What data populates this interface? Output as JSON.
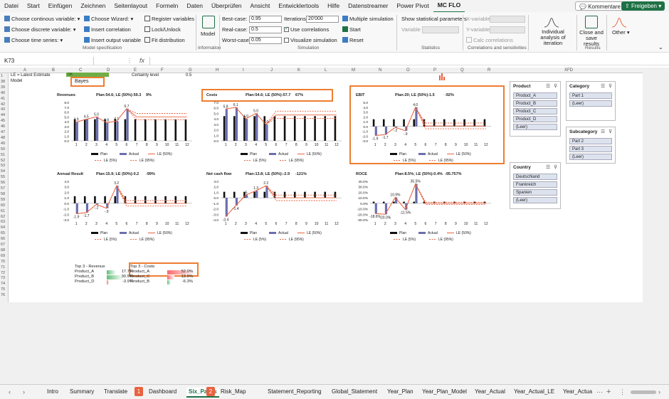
{
  "menu": {
    "tabs": [
      "Datei",
      "Start",
      "Einfügen",
      "Zeichnen",
      "Seitenlayout",
      "Formeln",
      "Daten",
      "Überprüfen",
      "Ansicht",
      "Entwicklertools",
      "Hilfe",
      "Datenstreamer",
      "Power Pivot",
      "MC FLO"
    ],
    "active": "MC FLO",
    "comments": "Kommentare",
    "share": "Freigeben"
  },
  "ribbon": {
    "model_spec": {
      "continuous": "Choose continous variable:",
      "discrete": "Choose discrete variable:",
      "time_series": "Choose time series:",
      "wizard": "Choose Wizard:",
      "insert_correlation": "Insert correlation",
      "insert_output": "Insert output variable",
      "register": "Register variables",
      "lock": "Lock/Unlock",
      "fit": "Fit distribution",
      "label": "Model specification"
    },
    "information": {
      "model": "Model",
      "label": "Information"
    },
    "simulation": {
      "best_case_label": "Best-case:",
      "best_case": "0.95",
      "real_case_label": "Real-case:",
      "real_case": "0.5",
      "worst_case_label": "Worst-case:",
      "worst_case": "0.05",
      "iterations_label": "Iterations:",
      "iterations": "20'000",
      "use_corr": "Use correlations",
      "visualize": "Visualize simulation",
      "multiple": "Multiple simulation",
      "start": "Start",
      "reset": "Reset",
      "label": "Simulation"
    },
    "statistics": {
      "show": "Show statistical parameters",
      "variable": "Variable",
      "label": "Statistics"
    },
    "correlations": {
      "xvar": "X-variable",
      "yvar": "Y-variable",
      "calc": "Calc correlations",
      "label": "Correlations and sensitivities"
    },
    "individual": "Individual analysis of iteration",
    "results": {
      "close": "Close and save results",
      "label": "Results"
    },
    "other": "Other"
  },
  "formula_bar": {
    "cell": "K73",
    "fx": "fx"
  },
  "columns": [
    "A",
    "B",
    "C",
    "D",
    "E",
    "F",
    "G",
    "H",
    "I",
    "J",
    "K",
    "L",
    "M",
    "N",
    "O",
    "P",
    "Q",
    "R",
    "XFD"
  ],
  "rows": [
    "1",
    "38",
    "39",
    "40",
    "41",
    "42",
    "43",
    "44",
    "45",
    "46",
    "47",
    "48",
    "49",
    "50",
    "51",
    "52",
    "53",
    "54",
    "55",
    "56",
    "57",
    "58",
    "59",
    "60",
    "61",
    "62",
    "63",
    "64",
    "65",
    "66",
    "67",
    "68",
    "69",
    "70",
    "71",
    "72",
    "73",
    "74",
    "75",
    "76"
  ],
  "cells": {
    "le_note": "LE = Latest Estimate",
    "ok": "OK",
    "certainty": "Certainty level",
    "certainty_value": "0.5",
    "model_label": "Model",
    "model_value": "Bayes"
  },
  "legend": {
    "plan": "Plan",
    "actual": "Actual",
    "le50": "LE (50%)",
    "le5": "LE (5%)",
    "le95": "LE (95%)"
  },
  "chart_data": [
    {
      "type": "bar",
      "title": "Revenues",
      "info": "Plan:54.6; LE (50%):59.3",
      "pct": "9%",
      "categories": [
        "1",
        "2",
        "3",
        "4",
        "5",
        "6",
        "7",
        "8",
        "9",
        "10",
        "11",
        "12"
      ],
      "ylim": [
        0,
        8
      ],
      "yticks": [
        "0.0",
        "1.0",
        "2.0",
        "3.0",
        "4.0",
        "5.0",
        "6.0",
        "7.0",
        "8.0"
      ],
      "series": [
        {
          "name": "Plan",
          "values": [
            4.5,
            4.5,
            4.5,
            4.5,
            4.5,
            4.5,
            4.5,
            4.5,
            4.5,
            4.5,
            4.5,
            4.5
          ]
        },
        {
          "name": "Actual",
          "values": [
            3.9,
            4.5,
            5.0,
            3.8,
            4.1,
            6.7
          ]
        },
        {
          "name": "LE (50%)",
          "values": [
            3.9,
            4.5,
            5.0,
            3.8,
            4.1,
            6.7,
            5.0,
            5.0,
            5.0,
            5.0,
            5.0,
            5.0
          ]
        },
        {
          "name": "LE (5%)",
          "values": [
            3.9,
            4.5,
            5.0,
            3.8,
            4.1,
            6.7,
            4.4,
            4.4,
            4.4,
            4.4,
            4.4,
            4.4
          ]
        },
        {
          "name": "LE (95%)",
          "values": [
            3.9,
            4.5,
            5.0,
            3.8,
            4.1,
            6.7,
            5.7,
            5.7,
            5.7,
            5.7,
            5.7,
            5.7
          ]
        }
      ],
      "labels": [
        "3.9",
        "4.5",
        "5.0",
        "3.8",
        "4.1",
        "6.7"
      ]
    },
    {
      "type": "bar",
      "title": "Costs",
      "info": "Plan:54.6; LE (50%):57.7",
      "pct": "67%",
      "categories": [
        "1",
        "2",
        "3",
        "4",
        "5",
        "6",
        "7",
        "8",
        "9",
        "10",
        "11",
        "12"
      ],
      "ylim": [
        0,
        7
      ],
      "yticks": [
        "0.0",
        "1.0",
        "2.0",
        "3.0",
        "4.0",
        "5.0",
        "6.0",
        "7.0"
      ],
      "series": [
        {
          "name": "Plan",
          "values": [
            4.5,
            4.5,
            4.5,
            4.5,
            4.5,
            4.5,
            4.5,
            4.5,
            4.5,
            4.5,
            4.5,
            4.5
          ]
        },
        {
          "name": "Actual",
          "values": [
            5.8,
            6.1,
            4.0,
            5.0,
            3.0
          ]
        },
        {
          "name": "LE (50%)",
          "values": [
            5.8,
            6.1,
            4.0,
            5.0,
            3.0,
            4.7,
            4.7,
            4.7,
            4.7,
            4.7,
            4.7,
            4.7
          ]
        },
        {
          "name": "LE (5%)",
          "values": [
            5.8,
            6.1,
            4.0,
            5.0,
            3.0,
            4.1,
            4.1,
            4.1,
            4.1,
            4.1,
            4.1,
            4.1
          ]
        },
        {
          "name": "LE (95%)",
          "values": [
            5.8,
            6.1,
            4.0,
            5.0,
            3.0,
            5.4,
            5.4,
            5.4,
            5.4,
            5.4,
            5.4,
            5.4
          ]
        }
      ],
      "labels": [
        "5.8",
        "6.1",
        "4.0",
        "5.0",
        "3.0"
      ]
    },
    {
      "type": "bar",
      "title": "EBIT",
      "info": "Plan:20; LE (50%):1.5",
      "pct": "-92%",
      "categories": [
        "1",
        "2",
        "3",
        "4",
        "5",
        "6",
        "7",
        "8",
        "9",
        "10",
        "11",
        "12"
      ],
      "ylim": [
        -3,
        5
      ],
      "yticks": [
        "-3.0",
        "-2.0",
        "-1.0",
        "0.0",
        "1.0",
        "2.0",
        "3.0",
        "4.0",
        "5.0"
      ],
      "series": [
        {
          "name": "Plan",
          "values": [
            1.5,
            1.5,
            1.5,
            1.5,
            1.5,
            1.5,
            1.5,
            1.5,
            1.5,
            1.5,
            1.5,
            1.5
          ]
        },
        {
          "name": "Actual",
          "values": [
            -1.9,
            -1.7,
            -0.2,
            -0.9,
            4.0
          ]
        },
        {
          "name": "LE (50%)",
          "values": [
            -1.9,
            -1.7,
            -0.2,
            -0.9,
            4.0,
            0.1,
            0.1,
            0.1,
            0.1,
            0.1,
            0.1,
            0.1
          ]
        },
        {
          "name": "LE (5%)",
          "values": [
            -1.9,
            -1.7,
            -0.2,
            -0.9,
            4.0,
            -0.5,
            -0.5,
            -0.5,
            -0.5,
            -0.5,
            -0.5,
            -0.5
          ]
        },
        {
          "name": "LE (95%)",
          "values": [
            -1.9,
            -1.7,
            -0.2,
            -0.9,
            4.0,
            0.7,
            0.7,
            0.7,
            0.7,
            0.7,
            0.7,
            0.7
          ]
        }
      ],
      "labels": [
        "-1.9",
        "-1.7",
        "-.2",
        "-.9",
        "4.0"
      ]
    },
    {
      "type": "bar",
      "title": "Annual Result",
      "info": "Plan:15.9; LE (50%):0.2",
      "pct": "-99%",
      "categories": [
        "1",
        "2",
        "3",
        "4",
        "5",
        "6",
        "7",
        "8",
        "9",
        "10",
        "11",
        "12"
      ],
      "ylim": [
        -3,
        4
      ],
      "yticks": [
        "-3.0",
        "-2.0",
        "-1.0",
        "0.0",
        "1.0",
        "2.0",
        "3.0",
        "4.0"
      ],
      "series": [
        {
          "name": "Plan",
          "values": [
            1.3,
            1.3,
            1.3,
            1.3,
            1.3,
            1.3,
            1.3,
            1.3,
            1.3,
            1.3,
            1.3,
            1.3
          ]
        },
        {
          "name": "Actual",
          "values": [
            -1.9,
            -1.7,
            -0.2,
            -0.9,
            3.2
          ]
        },
        {
          "name": "LE (50%)",
          "values": [
            -1.9,
            -1.7,
            -0.2,
            -0.9,
            3.2,
            0.0,
            0.0,
            0.0,
            0.0,
            0.0,
            0.0,
            0.0
          ]
        },
        {
          "name": "LE (5%)",
          "values": [
            -1.9,
            -1.7,
            -0.2,
            -0.9,
            3.2,
            -0.5,
            -0.5,
            -0.5,
            -0.5,
            -0.5,
            -0.5,
            -0.5
          ]
        },
        {
          "name": "LE (95%)",
          "values": [
            -1.9,
            -1.7,
            -0.2,
            -0.9,
            3.2,
            0.5,
            0.5,
            0.5,
            0.5,
            0.5,
            0.5,
            0.5
          ]
        }
      ],
      "labels": [
        "-1.9",
        "-1.7",
        "-.2",
        "-.9",
        "3.2"
      ]
    },
    {
      "type": "bar",
      "title": "Net cash flow",
      "info": "Plan:13.8; LE (50%):-2.9",
      "pct": "-121%",
      "categories": [
        "1",
        "2",
        "3",
        "4",
        "5",
        "6",
        "7",
        "8",
        "9",
        "10",
        "11",
        "12"
      ],
      "ylim": [
        -4,
        3
      ],
      "yticks": [
        "-4.0",
        "-3.0",
        "-2.0",
        "-1.0",
        "0.0",
        "1.0",
        "2.0",
        "3.0"
      ],
      "series": [
        {
          "name": "Plan",
          "values": [
            1.1,
            1.1,
            1.1,
            1.1,
            1.1,
            1.1,
            1.1,
            1.1,
            1.1,
            1.1,
            1.1,
            1.1
          ]
        },
        {
          "name": "Actual",
          "values": [
            -3.4,
            -1.4,
            0.5,
            1.3,
            2.2
          ]
        },
        {
          "name": "LE (50%)",
          "values": [
            -3.4,
            -1.4,
            0.5,
            1.3,
            2.2,
            0.0,
            0.0,
            0.0,
            0.0,
            0.0,
            0.0,
            0.0
          ]
        },
        {
          "name": "LE (5%)",
          "values": [
            -3.4,
            -1.4,
            0.5,
            1.3,
            2.2,
            -0.5,
            -0.5,
            -0.5,
            -0.5,
            -0.5,
            -0.5,
            -0.5
          ]
        },
        {
          "name": "LE (95%)",
          "values": [
            -3.4,
            -1.4,
            0.5,
            1.3,
            2.2,
            0.5,
            0.5,
            0.5,
            0.5,
            0.5,
            0.5,
            0.5
          ]
        }
      ],
      "labels": [
        "-3.4",
        "-1.4",
        ".5",
        "1.3",
        "2.2"
      ]
    },
    {
      "type": "bar",
      "title": "ROCE",
      "info": "Plan:8.5%; LE (50%):0.4%",
      "pct": "-95.757%",
      "categories": [
        "1",
        "2",
        "3",
        "4",
        "5",
        "6",
        "7",
        "8",
        "9",
        "10",
        "11",
        "12"
      ],
      "ylim": [
        -30,
        40
      ],
      "yticks": [
        "-30.0%",
        "-20.0%",
        "-10.0%",
        "0.0%",
        "10.0%",
        "20.0%",
        "30.0%",
        "40.0%"
      ],
      "series": [
        {
          "name": "Plan",
          "values": [
            3,
            3,
            3,
            3,
            3,
            3,
            3,
            3,
            3,
            3,
            3,
            3
          ]
        },
        {
          "name": "Actual",
          "values": [
            -18.6,
            -20.0,
            10.9,
            -11.5,
            35.5
          ]
        },
        {
          "name": "LE (50%)",
          "values": [
            -18.6,
            -20.0,
            10.9,
            -11.5,
            35.5,
            0.1,
            0.1,
            0.1,
            0.1,
            0.1,
            0.1,
            0.1
          ]
        },
        {
          "name": "LE (5%)",
          "values": [
            -18.6,
            -20.0,
            10.9,
            -11.5,
            35.5,
            -2,
            -2,
            -2,
            -2,
            -2,
            -2,
            -2
          ]
        },
        {
          "name": "LE (95%)",
          "values": [
            -18.6,
            -20.0,
            10.9,
            -11.5,
            35.5,
            2,
            2,
            2,
            2,
            2,
            2,
            2
          ]
        }
      ],
      "labels": [
        "-18.6%",
        "-20.0%",
        "10.9%",
        "-11.5%",
        "35.5%"
      ]
    }
  ],
  "slicers": {
    "product": {
      "title": "Product",
      "items": [
        "Product_A",
        "Product_B",
        "Product_C",
        "Product_D",
        "(Leer)"
      ]
    },
    "category": {
      "title": "Category",
      "items": [
        "Part 1",
        "(Leer)"
      ]
    },
    "subcategory": {
      "title": "Subcategory",
      "items": [
        "Part 2",
        "Part 3",
        "(Leer)"
      ]
    },
    "country": {
      "title": "Country",
      "items": [
        "Deutschland",
        "Frankreich",
        "Spanien",
        "(Leer)"
      ]
    }
  },
  "top3": {
    "revenue": {
      "title": "Top 3 - Revenue",
      "rows": [
        {
          "name": "Product_A",
          "value": "17.7%",
          "frac": 0.177
        },
        {
          "name": "Product_B",
          "value": "30.5%",
          "frac": 0.305
        },
        {
          "name": "Product_D",
          "value": "-3.9%",
          "frac": -0.039
        }
      ]
    },
    "costs": {
      "title": "Top 3 - Costs",
      "rows": [
        {
          "name": "Product_A",
          "value": "52.0%",
          "frac": 0.52
        },
        {
          "name": "Product_C",
          "value": "13.9%",
          "frac": 0.139
        },
        {
          "name": "Product_B",
          "value": "-6.3%",
          "frac": -0.063
        }
      ]
    }
  },
  "sheet_tabs": [
    "Intro",
    "Summary",
    "Translate",
    "Dashboard",
    "Six_Packs",
    "Risk_Map",
    "Statement_Reporting",
    "Global_Statement",
    "Year_Plan",
    "Year_Plan_Model",
    "Year_Actual",
    "Year_Actual_LE",
    "Year_Actua"
  ],
  "active_sheet": "Six_Packs",
  "badges": [
    "1",
    "2"
  ],
  "colors": {
    "plan": "#111111",
    "actual": "#6b6fae",
    "le": "#e8623f",
    "orange": "#ee7d31",
    "green": "#1e7145"
  }
}
